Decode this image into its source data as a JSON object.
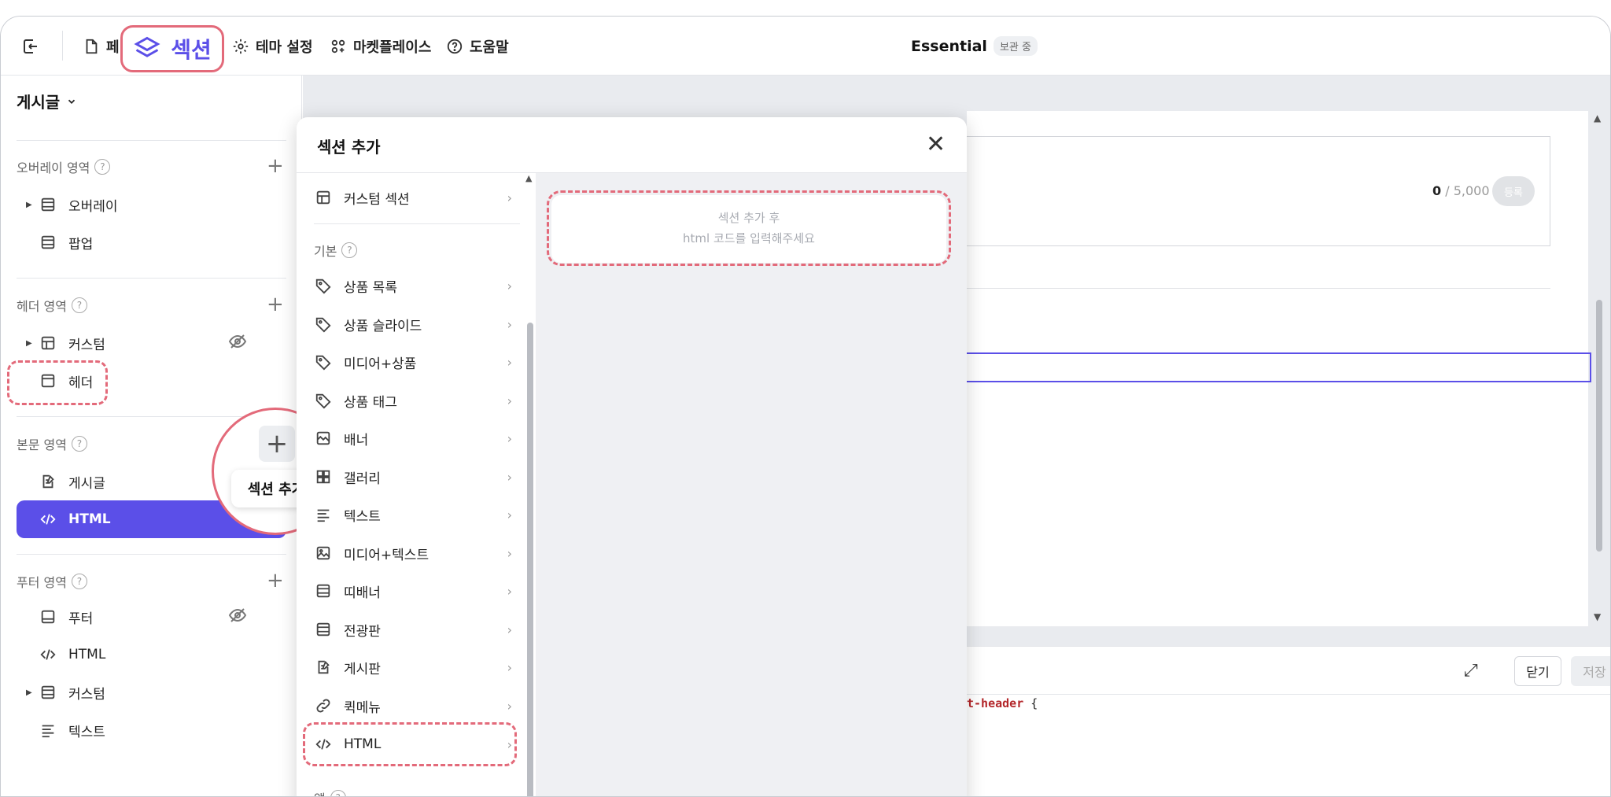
{
  "topbar": {
    "page_label_partial": "페",
    "section_label": "섹션",
    "theme_settings": "테마 설정",
    "marketplace": "마켓플레이스",
    "help": "도움말",
    "title": "Essential",
    "badge": "보관 중"
  },
  "sidebar": {
    "header": "게시글",
    "groups": {
      "overlay": "오버레이 영역",
      "header": "헤더 영역",
      "body": "본문 영역",
      "footer": "푸터 영역"
    },
    "overlay_items": [
      "오버레이",
      "팝업"
    ],
    "header_items": [
      "커스텀",
      "헤더"
    ],
    "body_items": [
      "게시글",
      "HTML"
    ],
    "footer_items": [
      "푸터",
      "HTML",
      "커스텀",
      "텍스트"
    ],
    "add_section_tooltip": "섹션 추가"
  },
  "modal": {
    "title": "섹션 추가",
    "custom_section": "커스텀 섹션",
    "basic_label": "기본",
    "basic_items": [
      "상품 목록",
      "상품 슬라이드",
      "미디어+상품",
      "상품 태그",
      "배너",
      "갤러리",
      "텍스트",
      "미디어+텍스트",
      "띠배너",
      "전광판",
      "게시판",
      "퀵메뉴",
      "HTML"
    ],
    "app_label": "앱",
    "preview_line1": "섹션 추가 후",
    "preview_line2": "html 코드를 입력해주세요"
  },
  "editor": {
    "count_current": "0",
    "count_max": " / 5,000",
    "register_button": "등록",
    "close_button": "닫기",
    "save_button": "저장",
    "code_fragment": "t-header",
    "code_tail": " {"
  },
  "colors": {
    "accent": "#5b4fe8",
    "highlight": "#e36a7a"
  }
}
